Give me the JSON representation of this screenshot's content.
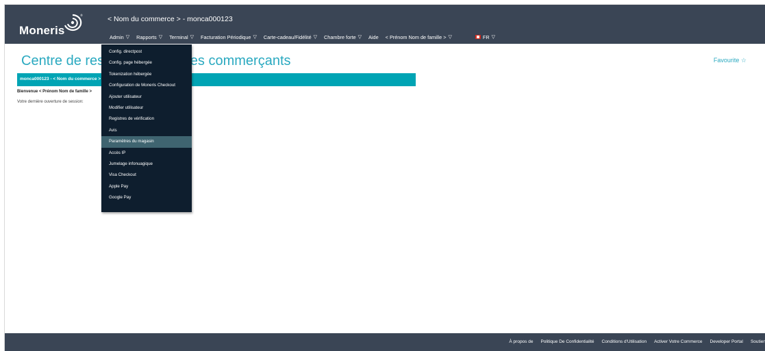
{
  "header": {
    "logo_text": "Moneris",
    "merchant_line": "< Nom du commerce > - monca000123",
    "nav": [
      {
        "label": "Admin",
        "has_arrow": true
      },
      {
        "label": "Rapports",
        "has_arrow": true
      },
      {
        "label": "Terminal",
        "has_arrow": true
      },
      {
        "label": "Facturation Périodique",
        "has_arrow": true
      },
      {
        "label": "Carte-cadeau/Fidélité",
        "has_arrow": true
      },
      {
        "label": "Chambre forte",
        "has_arrow": true
      },
      {
        "label": "Aide",
        "has_arrow": false
      },
      {
        "label": "< Prénom Nom de famille >",
        "has_arrow": true
      },
      {
        "label": "FR",
        "has_arrow": true
      }
    ]
  },
  "main": {
    "title": "Centre de ressources pour les commerçants",
    "favourite": "Favourite ☆",
    "bar_text": "monca000123 - < Nom du commerce >",
    "welcome": "Bienvenue < Prénom Nom de famille >",
    "last_login": "Votre dernière ouverture de session:"
  },
  "admin_menu": {
    "items": [
      "Config. directpost",
      "Config. page hébergée",
      "Tokenization hébergée",
      "Configuration de Moneris Checkout",
      "Ajouter utilisateur",
      "Modifier utilisateur",
      "Registres de vérification",
      "Avis",
      "Paramètres du magasin",
      "Accès IP",
      "Jumelage infonuagique",
      "Visa Checkout",
      "Apple Pay",
      "Google Pay"
    ],
    "active_index": 8
  },
  "footer": {
    "links": [
      "À propos de",
      "Politique De Confidentialité",
      "Conditions d'Utilisation",
      "Activer Votre Commerce",
      "Developer Portal",
      "Soutien"
    ]
  },
  "colors": {
    "header_bg": "#3a4555",
    "accent": "#2aa9c0",
    "bar": "#00a4b4",
    "menu_bg": "#0e1e2e",
    "menu_active": "#3f6470"
  }
}
